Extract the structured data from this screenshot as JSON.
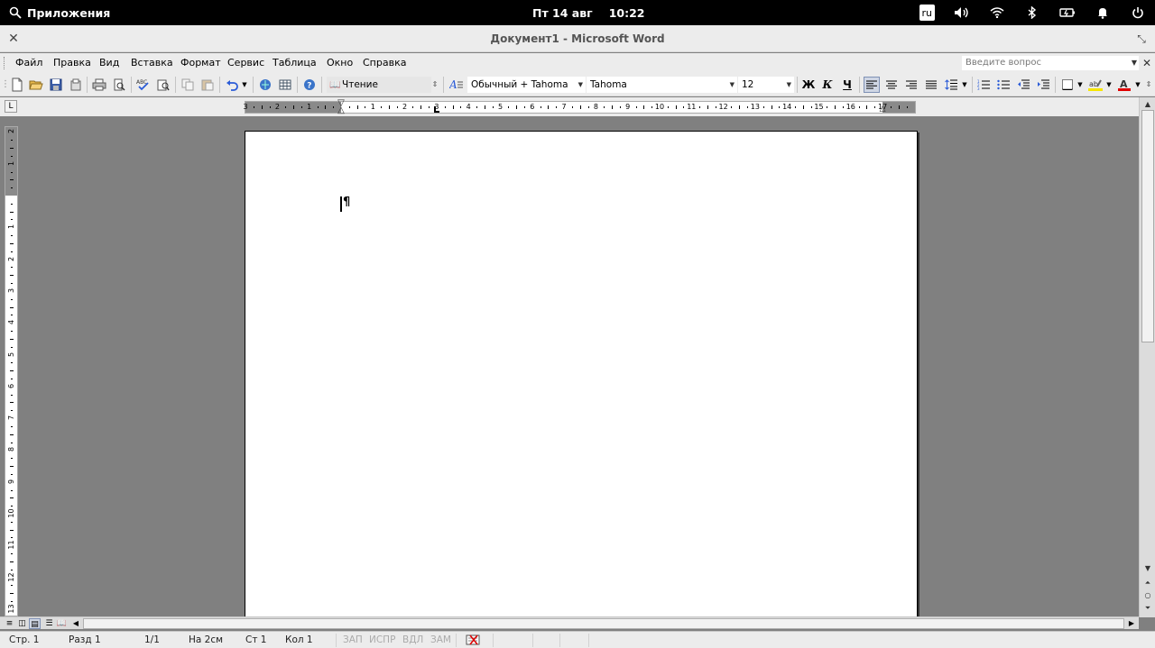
{
  "topbar": {
    "apps_label": "Приложения",
    "date": "Пт 14 авг",
    "time": "10:22",
    "lang": "ru"
  },
  "window": {
    "title": "Документ1 - Microsoft Word"
  },
  "menu": {
    "items": [
      "Файл",
      "Правка",
      "Вид",
      "Вставка",
      "Формат",
      "Сервис",
      "Таблица",
      "Окно",
      "Справка"
    ],
    "help_placeholder": "Введите вопрос"
  },
  "toolbar": {
    "reading_label": "Чтение",
    "style": "Обычный + Tahoma",
    "font": "Tahoma",
    "size": "12",
    "bold": "Ж",
    "italic": "К",
    "underline": "Ч"
  },
  "ruler": {
    "h_numbers": [
      "3",
      "2",
      "1",
      "1",
      "2",
      "3",
      "4",
      "5",
      "6",
      "7",
      "8",
      "9",
      "10",
      "11",
      "12",
      "13",
      "14",
      "15",
      "16",
      "17"
    ],
    "v_numbers": [
      "2",
      "1",
      "1",
      "2",
      "3",
      "4",
      "5",
      "6",
      "7",
      "8",
      "9",
      "10",
      "11",
      "12",
      "13"
    ]
  },
  "status": {
    "page": "Стр. 1",
    "section": "Разд 1",
    "pages": "1/1",
    "at": "На 2см",
    "line": "Ст 1",
    "col": "Кол 1",
    "rec": "ЗАП",
    "trk": "ИСПР",
    "ext": "ВДЛ",
    "ovr": "ЗАМ"
  },
  "colors": {
    "highlight": "#f7e600",
    "font_color": "#e00000"
  }
}
